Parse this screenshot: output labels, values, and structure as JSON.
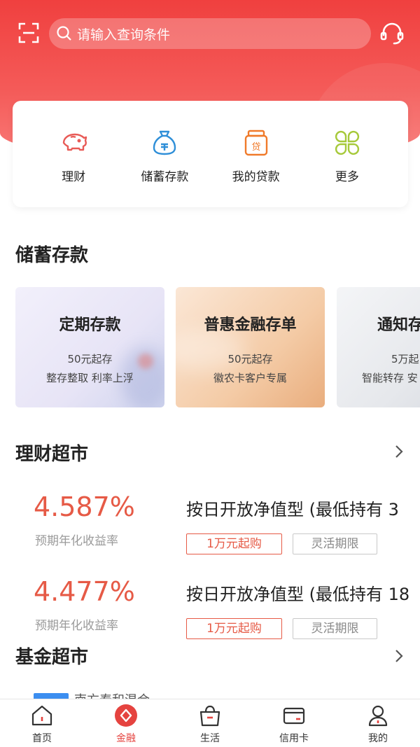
{
  "header": {
    "search_placeholder": "请输入查询条件",
    "icons": [
      "scan-icon",
      "search-icon",
      "headset-icon"
    ]
  },
  "quick_menu": [
    {
      "label": "理财",
      "icon": "piggy-bank-icon"
    },
    {
      "label": "储蓄存款",
      "icon": "money-bag-icon"
    },
    {
      "label": "我的贷款",
      "icon": "loan-jar-icon"
    },
    {
      "label": "更多",
      "icon": "clover-grid-icon"
    }
  ],
  "savings": {
    "title": "储蓄存款",
    "cards": [
      {
        "title": "定期存款",
        "line1": "50元起存",
        "line2": "整存整取  利率上浮"
      },
      {
        "title": "普惠金融存单",
        "line1": "50元起存",
        "line2": "徽农卡客户专属"
      },
      {
        "title": "通知存",
        "line1": "5万起",
        "line2": "智能转存  安"
      }
    ]
  },
  "wealth": {
    "title": "理财超市",
    "products": [
      {
        "rate": "4.587%",
        "rate_label": "预期年化收益率",
        "name": "按日开放净值型 (最低持有 3",
        "tag1": "1万元起购",
        "tag2": "灵活期限"
      },
      {
        "rate": "4.477%",
        "rate_label": "预期年化收益率",
        "name": "按日开放净值型 (最低持有 18",
        "tag1": "1万元起购",
        "tag2": "灵活期限"
      }
    ]
  },
  "fund": {
    "title": "基金超市",
    "peek_text": "南方泰和混合"
  },
  "tabbar": [
    {
      "label": "首页",
      "icon": "home-icon",
      "active": false
    },
    {
      "label": "金融",
      "icon": "finance-icon",
      "active": true
    },
    {
      "label": "生活",
      "icon": "shopping-bag-icon",
      "active": false
    },
    {
      "label": "信用卡",
      "icon": "credit-card-icon",
      "active": false
    },
    {
      "label": "我的",
      "icon": "person-icon",
      "active": false
    }
  ],
  "colors": {
    "brand": "#f0403f",
    "rate": "#e65a46",
    "active_tab": "#e5433f"
  }
}
